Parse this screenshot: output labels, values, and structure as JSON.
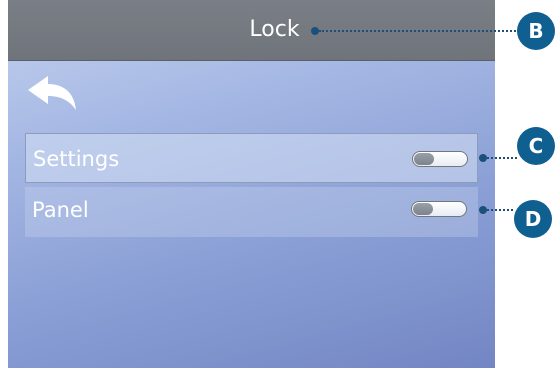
{
  "screen": {
    "title": "Lock",
    "back_icon": "back-arrow-icon",
    "rows": [
      {
        "label": "Settings",
        "toggle_on": false,
        "selected": true
      },
      {
        "label": "Panel",
        "toggle_on": false,
        "selected": false
      }
    ]
  },
  "callouts": {
    "title": "B",
    "settings_toggle": "C",
    "panel_toggle": "D"
  },
  "colors": {
    "callout": "#0f5f91",
    "titlebar": "#757a81"
  }
}
